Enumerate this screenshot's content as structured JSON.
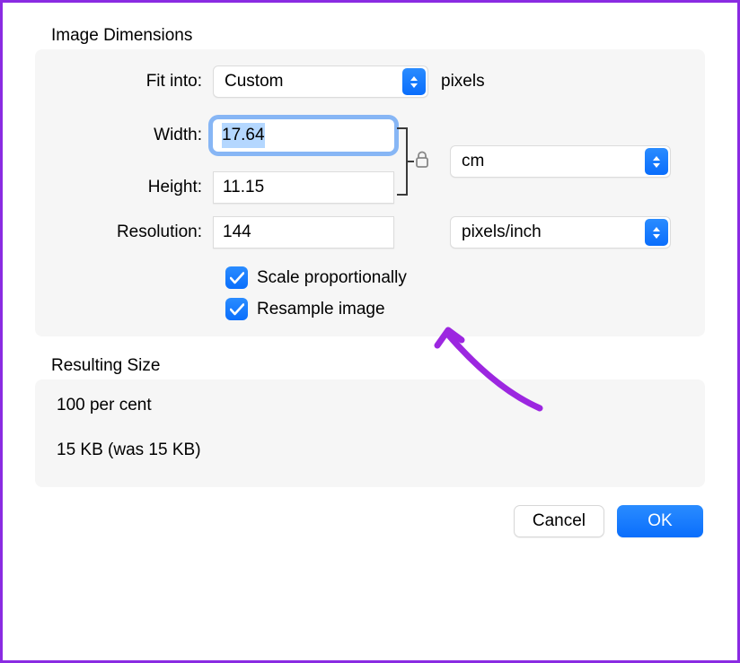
{
  "dimensions": {
    "title": "Image Dimensions",
    "fit_into_label": "Fit into:",
    "fit_into_value": "Custom",
    "fit_into_unit": "pixels",
    "width_label": "Width:",
    "width_value": "17.64",
    "height_label": "Height:",
    "height_value": "11.15",
    "wh_unit": "cm",
    "resolution_label": "Resolution:",
    "resolution_value": "144",
    "resolution_unit": "pixels/inch",
    "scale_proportionally_label": "Scale proportionally",
    "scale_proportionally_checked": true,
    "resample_label": "Resample image",
    "resample_checked": true
  },
  "result": {
    "title": "Resulting Size",
    "percent_line": "100 per cent",
    "size_line": "15 KB (was 15 KB)"
  },
  "buttons": {
    "cancel": "Cancel",
    "ok": "OK"
  },
  "colors": {
    "accent": "#0a6efc",
    "annotation": "#9c27e0"
  }
}
